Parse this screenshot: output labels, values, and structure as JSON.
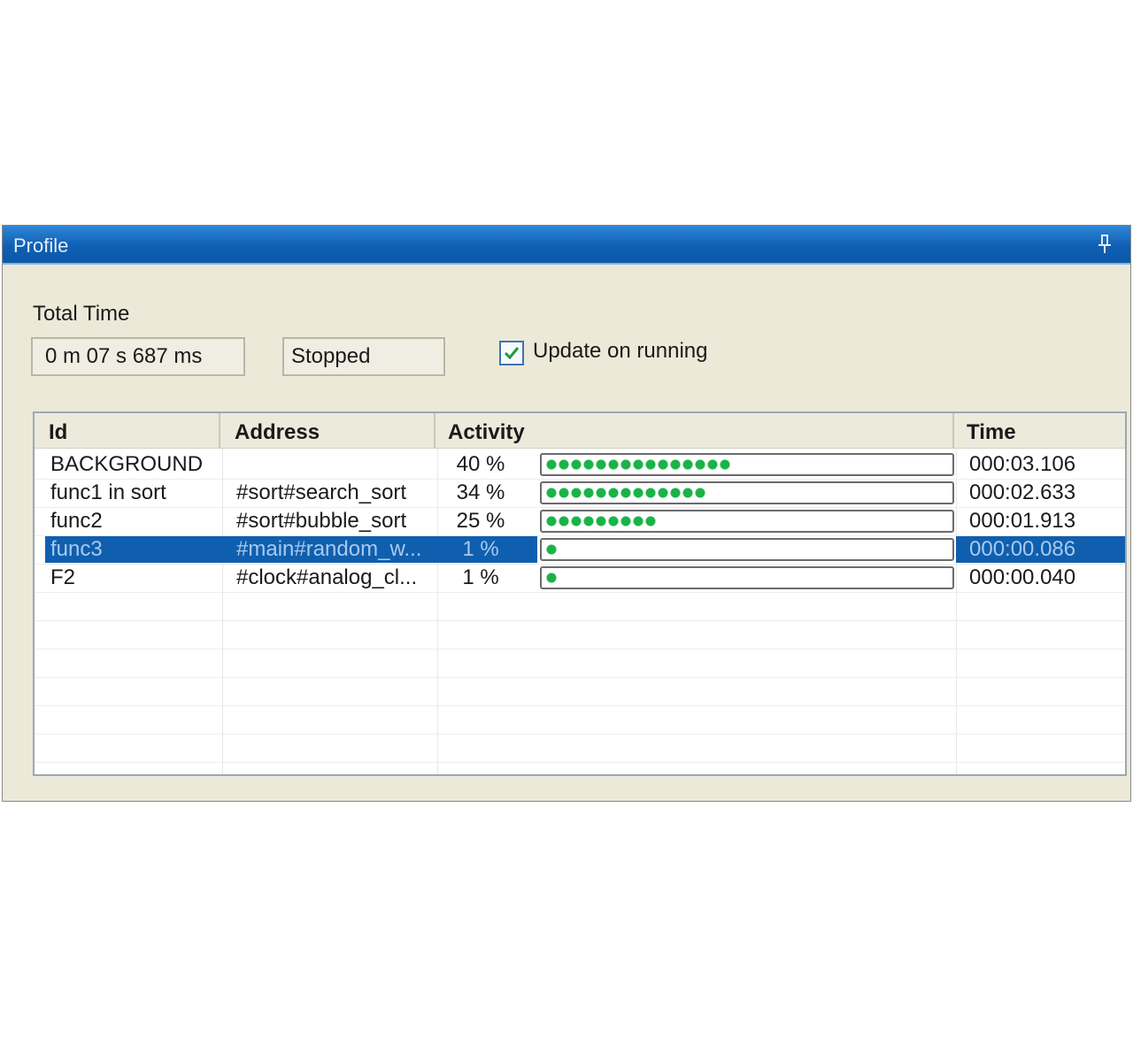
{
  "window": {
    "title": "Profile"
  },
  "total_time": {
    "label": "Total Time",
    "value": "0 m 07 s 687 ms",
    "status": "Stopped"
  },
  "update_checkbox": {
    "label": "Update on running",
    "checked": true
  },
  "table": {
    "columns": [
      "Id",
      "Address",
      "Activity",
      "Time"
    ],
    "rows": [
      {
        "id": "BACKGROUND",
        "address": "",
        "activity": "40 %",
        "activity_fraction": 0.4,
        "time": "000:03.106",
        "selected": false
      },
      {
        "id": "func1 in sort",
        "address": "#sort#search_sort",
        "activity": "34 %",
        "activity_fraction": 0.34,
        "time": "000:02.633",
        "selected": false
      },
      {
        "id": "func2",
        "address": "#sort#bubble_sort",
        "activity": "25 %",
        "activity_fraction": 0.25,
        "time": "000:01.913",
        "selected": false
      },
      {
        "id": "func3",
        "address": "#main#random_w...",
        "activity": "1 %",
        "activity_fraction": 0.01,
        "time": "000:00.086",
        "selected": true
      },
      {
        "id": "F2",
        "address": "#clock#analog_cl...",
        "activity": "1 %",
        "activity_fraction": 0.01,
        "time": "000:00.040",
        "selected": false
      }
    ]
  },
  "colors": {
    "titlebar": "#0f5fb4",
    "selection": "#0f5fae",
    "activity_dots": "#19b347",
    "window_bg": "#ece9d8"
  },
  "icons": {
    "pin": "pin-icon",
    "check": "checkmark-icon"
  }
}
